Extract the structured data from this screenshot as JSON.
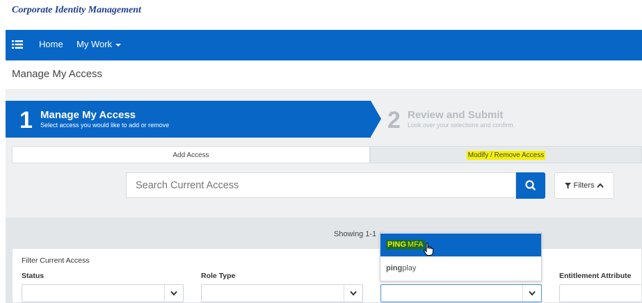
{
  "header": {
    "brand": "Corporate Identity Management"
  },
  "nav": {
    "items": [
      {
        "label": "Home"
      },
      {
        "label": "My Work"
      }
    ]
  },
  "page": {
    "title": "Manage My Access"
  },
  "steps": [
    {
      "number": "1",
      "title": "Manage My Access",
      "subtitle": "Select access you would like to add or remove",
      "active": true
    },
    {
      "number": "2",
      "title": "Review and Submit",
      "subtitle": "Look over your selections and confirm.",
      "active": false
    }
  ],
  "tabs": [
    {
      "label": "Add Access"
    },
    {
      "label": "Modify / Remove Access"
    }
  ],
  "search": {
    "placeholder": "Search Current Access",
    "value": ""
  },
  "filters_button": {
    "label": "Filters"
  },
  "results": {
    "showing": "Showing 1-1"
  },
  "filter_panel": {
    "title": "Filter Current Access",
    "fields": [
      {
        "label": "Status",
        "value": ""
      },
      {
        "label": "Role Type",
        "value": ""
      },
      {
        "label": "",
        "value": ""
      },
      {
        "label": "Entitlement Attribute",
        "value": ""
      }
    ]
  },
  "dropdown": {
    "options": [
      {
        "match": "PING",
        "rest": "MFA",
        "selected": true
      },
      {
        "match": "ping",
        "rest": "play",
        "selected": false
      }
    ]
  },
  "colors": {
    "primary": "#0866c6",
    "highlight": "#f5f10a",
    "match_bg": "#1c6a2c",
    "match_fg": "#ecf40c"
  },
  "icons": [
    "list-menu-icon",
    "caret-down-icon",
    "search-icon",
    "filter-icon",
    "chevron-up-icon",
    "chevron-down-icon",
    "hand-pointer-icon"
  ]
}
